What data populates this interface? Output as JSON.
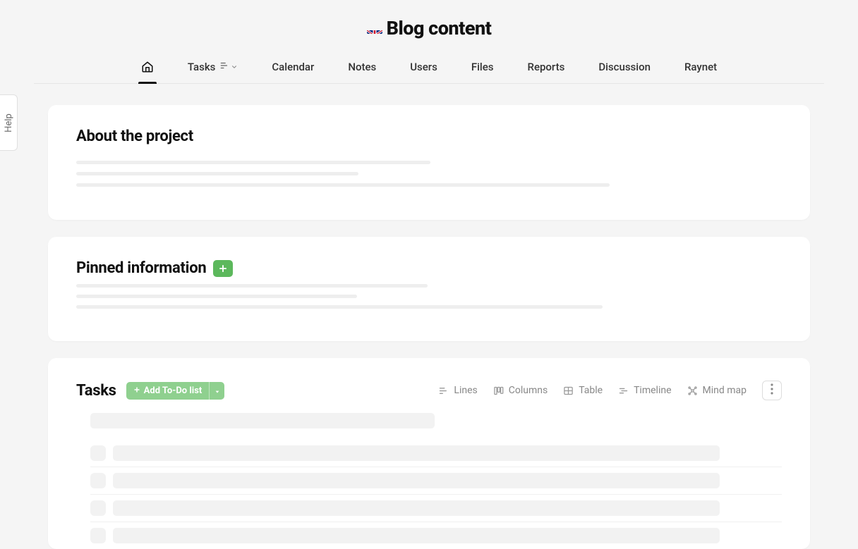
{
  "help_label": "Help",
  "page_title": "Blog content",
  "tabs": {
    "tasks": "Tasks",
    "calendar": "Calendar",
    "notes": "Notes",
    "users": "Users",
    "files": "Files",
    "reports": "Reports",
    "discussion": "Discussion",
    "raynet": "Raynet"
  },
  "sections": {
    "about_title": "About the project",
    "pinned_title": "Pinned information",
    "tasks_title": "Tasks"
  },
  "actions": {
    "add_todo": "Add To-Do list"
  },
  "views": {
    "lines": "Lines",
    "columns": "Columns",
    "table": "Table",
    "timeline": "Timeline",
    "mindmap": "Mind map"
  }
}
